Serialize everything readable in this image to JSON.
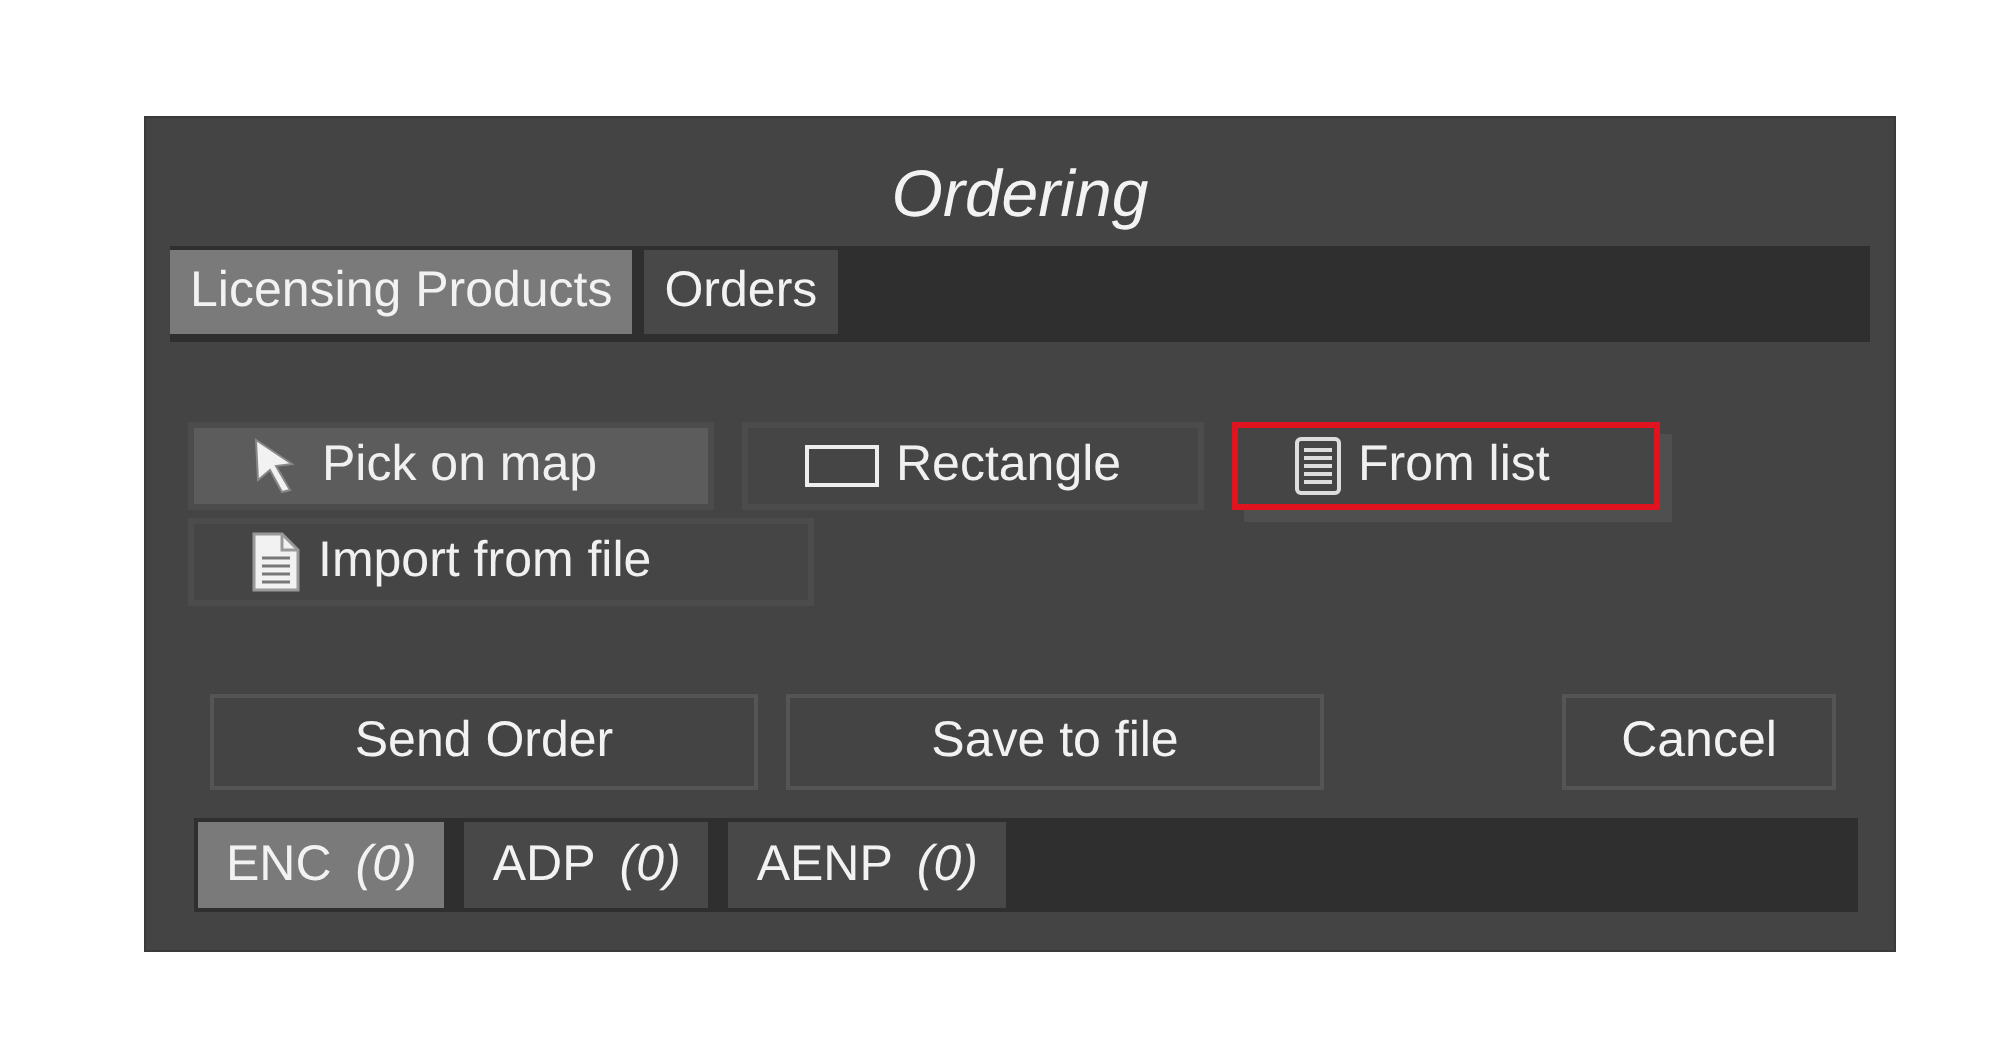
{
  "window": {
    "title": "Ordering"
  },
  "tabs": [
    {
      "label": "Licensing Products",
      "selected": true
    },
    {
      "label": "Orders",
      "selected": false
    }
  ],
  "tools": [
    {
      "kind": "pointer",
      "label": "Pick on map",
      "selected": true,
      "highlighted": false
    },
    {
      "kind": "rectangle",
      "label": "Rectangle",
      "selected": false,
      "highlighted": false
    },
    {
      "kind": "list",
      "label": "From list",
      "selected": false,
      "highlighted": true
    },
    {
      "kind": "file",
      "label": "Import from file",
      "selected": false,
      "highlighted": false
    }
  ],
  "actions": [
    {
      "label": "Send Order"
    },
    {
      "label": "Save to file"
    },
    {
      "label": "Cancel"
    }
  ],
  "product_tabs": [
    {
      "label": "ENC",
      "count": "(0)",
      "selected": true
    },
    {
      "label": "ADP",
      "count": "(0)",
      "selected": false
    },
    {
      "label": "AENP",
      "count": "(0)",
      "selected": false
    }
  ]
}
